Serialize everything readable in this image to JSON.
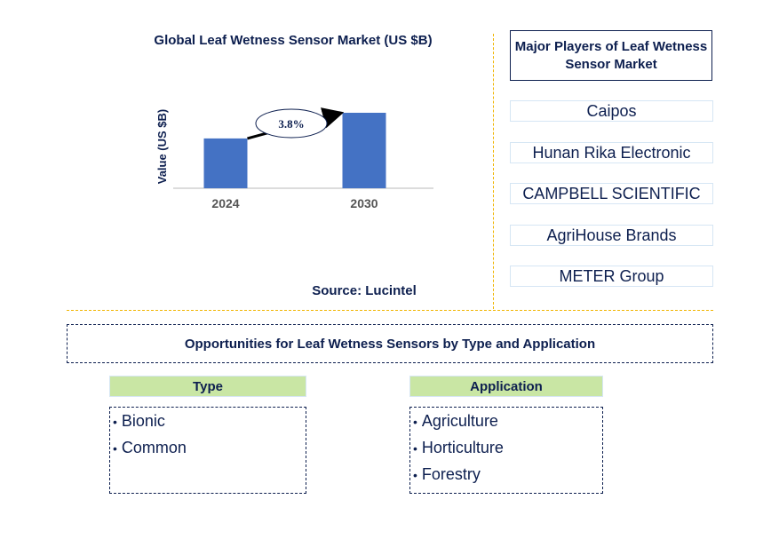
{
  "chart_data": {
    "type": "bar",
    "title": "Global Leaf Wetness Sensor Market (US $B)",
    "categories": [
      "2024",
      "2030"
    ],
    "values": [
      0.66,
      1.0
    ],
    "value_note": "relative bar heights; no numeric axis labels shown",
    "xlabel": "",
    "ylabel": "Value (US $B)",
    "annotation": {
      "label": "3.8%",
      "meaning": "CAGR 2024-2030"
    },
    "bar_color": "#4472c4",
    "grid": false,
    "legend": "none"
  },
  "source": "Source: Lucintel",
  "players": {
    "title": "Major Players of Leaf Wetness Sensor Market",
    "items": [
      "Caipos",
      "Hunan Rika Electronic",
      "CAMPBELL SCIENTIFIC",
      "AgriHouse Brands",
      "METER Group"
    ]
  },
  "opportunities": {
    "title": "Opportunities for Leaf Wetness Sensors by Type and Application",
    "type": {
      "header": "Type",
      "items": [
        "Bionic",
        "Common"
      ]
    },
    "application": {
      "header": "Application",
      "items": [
        "Agriculture",
        "Horticulture",
        "Forestry"
      ]
    }
  },
  "colors": {
    "text": "#0d1f4f",
    "divider": "#f0b400",
    "category_header": "#c9e6a4",
    "bar": "#4472c4"
  }
}
